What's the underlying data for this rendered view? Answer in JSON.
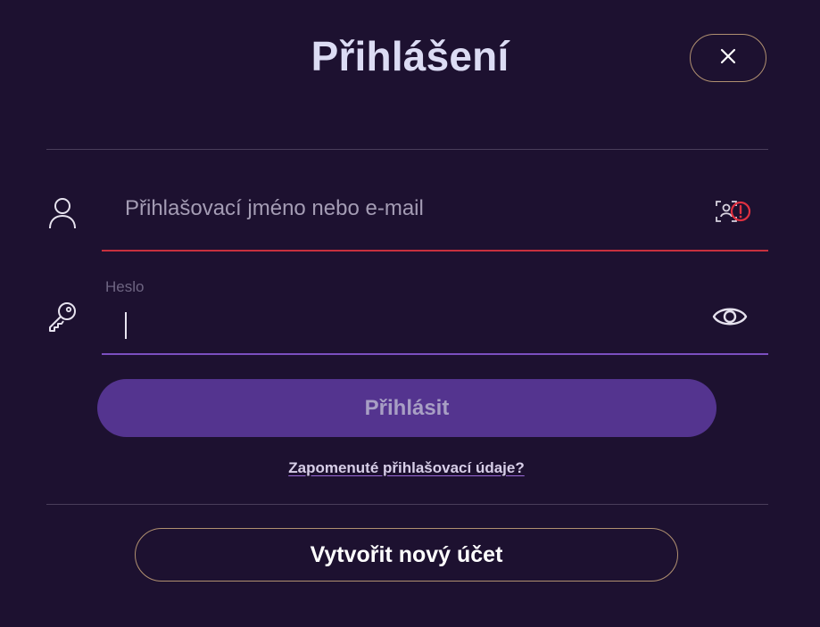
{
  "dialog": {
    "title": "Přihlášení",
    "close_label": "×"
  },
  "username": {
    "placeholder": "Přihlašovací jméno nebo e-mail",
    "value": "",
    "icon": "user-icon",
    "trailing_icon": "face-id-error-icon"
  },
  "password": {
    "label": "Heslo",
    "value": "",
    "icon": "key-icon",
    "trailing_icon": "eye-icon"
  },
  "actions": {
    "submit_label": "Přihlásit",
    "forgot_label": "Zapomenuté přihlašovací údaje?",
    "create_account_label": "Vytvořit nový účet"
  },
  "colors": {
    "background": "#1d1130",
    "error_underline": "#c7303e",
    "focus_underline": "#7b4fc0",
    "submit_bg": "#54348f",
    "outline_gold": "#b09070"
  }
}
